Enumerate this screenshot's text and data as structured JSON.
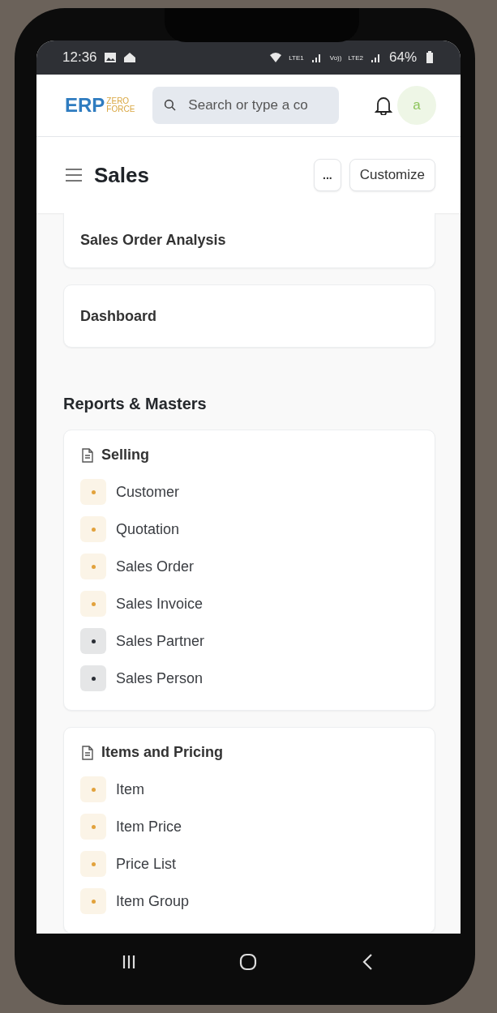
{
  "status_bar": {
    "time": "12:36",
    "network_1": "LTE1",
    "network_2": "LTE2",
    "volte": "Vo))",
    "battery": "64%"
  },
  "header": {
    "logo": {
      "main": "ERP",
      "sub_1": "ZERO",
      "sub_2": "FORCE"
    },
    "search": {
      "placeholder": "Search or type a co"
    },
    "avatar": "a"
  },
  "page": {
    "title": "Sales",
    "buttons": [
      "...",
      "Customize"
    ]
  },
  "shortcuts": [
    {
      "label": "Sales Order Analysis"
    },
    {
      "label": "Dashboard"
    }
  ],
  "section_title": "Reports & Masters",
  "cards": [
    {
      "title": "Selling",
      "links": [
        {
          "label": "Customer",
          "color": "#e2a23c"
        },
        {
          "label": "Quotation",
          "color": "#e2a23c"
        },
        {
          "label": "Sales Order",
          "color": "#e2a23c"
        },
        {
          "label": "Sales Invoice",
          "color": "#e2a23c"
        },
        {
          "label": "Sales Partner",
          "color": "#2b2f36"
        },
        {
          "label": "Sales Person",
          "color": "#2b2f36"
        }
      ]
    },
    {
      "title": "Items and Pricing",
      "links": [
        {
          "label": "Item",
          "color": "#e2a23c"
        },
        {
          "label": "Item Price",
          "color": "#e2a23c"
        },
        {
          "label": "Price List",
          "color": "#e2a23c"
        },
        {
          "label": "Item Group",
          "color": "#e2a23c"
        }
      ]
    }
  ]
}
